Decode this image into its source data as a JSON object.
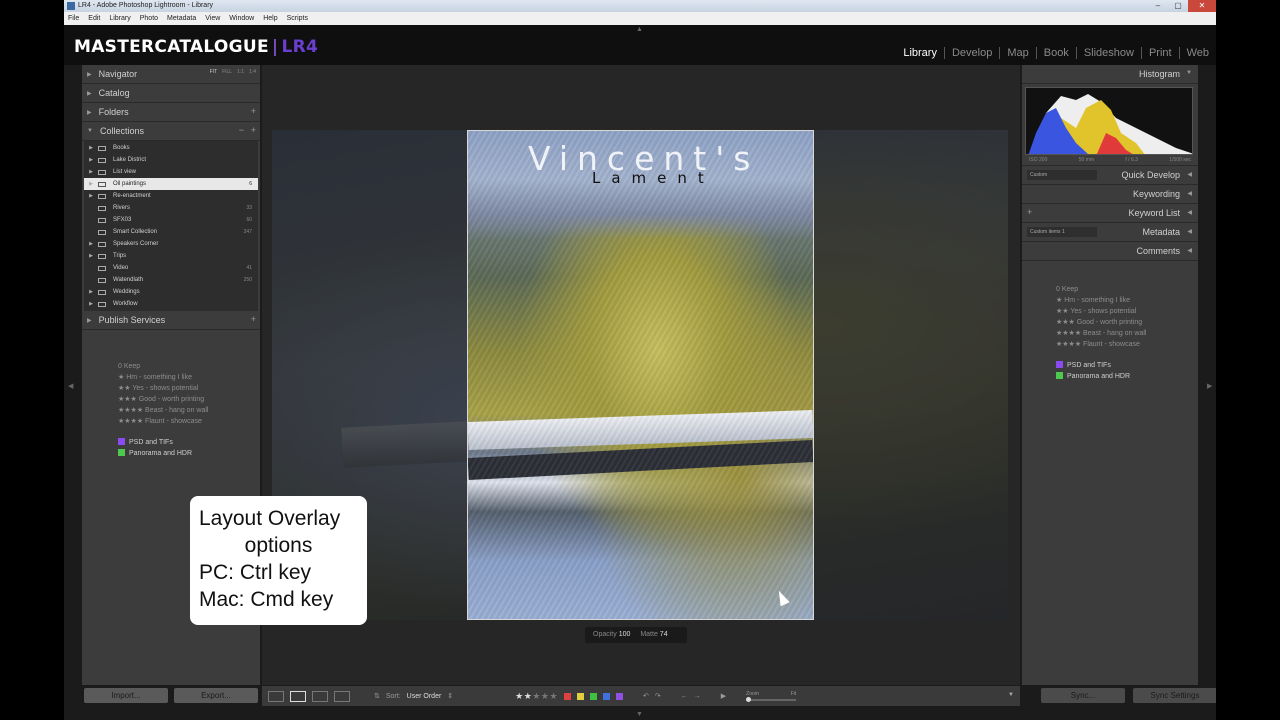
{
  "window": {
    "title": "LR4 - Adobe Photoshop Lightroom - Library",
    "menu": [
      "File",
      "Edit",
      "Library",
      "Photo",
      "Metadata",
      "View",
      "Window",
      "Help",
      "Scripts"
    ]
  },
  "identity": {
    "main": "MASTERCATALOGUE",
    "separator": "|",
    "badge": "LR4"
  },
  "modules": [
    {
      "label": "Library",
      "active": true
    },
    {
      "label": "Develop"
    },
    {
      "label": "Map"
    },
    {
      "label": "Book"
    },
    {
      "label": "Slideshow"
    },
    {
      "label": "Print"
    },
    {
      "label": "Web"
    }
  ],
  "left": {
    "navigator": {
      "label": "Navigator",
      "options": [
        "FIT",
        "FILL",
        "1:1",
        "1:4"
      ]
    },
    "catalog": "Catalog",
    "folders": "Folders",
    "collections": {
      "label": "Collections",
      "items": [
        {
          "name": "Books",
          "count": ""
        },
        {
          "name": "Lake District",
          "count": ""
        },
        {
          "name": "List view",
          "count": ""
        },
        {
          "name": "Oil paintings",
          "count": "6",
          "selected": true
        },
        {
          "name": "Re-enactment",
          "count": ""
        },
        {
          "name": "Rivers",
          "count": "33"
        },
        {
          "name": "SFX03",
          "count": "60"
        },
        {
          "name": "Smart Collection",
          "count": "247"
        },
        {
          "name": "Speakers Corner",
          "count": ""
        },
        {
          "name": "Trips",
          "count": ""
        },
        {
          "name": "Video",
          "count": "41"
        },
        {
          "name": "Watendlath",
          "count": "250"
        },
        {
          "name": "Weddings",
          "count": ""
        },
        {
          "name": "Workflow",
          "count": ""
        }
      ]
    },
    "publish": "Publish Services",
    "import_label": "Import...",
    "export_label": "Export..."
  },
  "legend": {
    "ratings": [
      "0 Keep",
      "★ Hm - something I like",
      "★★ Yes - shows potential",
      "★★★ Good - worth printing",
      "★★★★ Beast - hang on wall",
      "★★★★ Flaunt - showcase"
    ],
    "colors": [
      {
        "label": "PSD and TIFs",
        "color": "#8a4cf0"
      },
      {
        "label": "Panorama and HDR",
        "color": "#4ec94e"
      }
    ]
  },
  "overlay": {
    "title": "Vincent's",
    "subtitle": "Lament",
    "opacity_label": "Opacity",
    "opacity": "100",
    "matte_label": "Matte",
    "matte": "74"
  },
  "callout": {
    "line1": "Layout Overlay",
    "line2": "options",
    "line3": "PC: Ctrl key",
    "line4": "Mac: Cmd key"
  },
  "right": {
    "histogram": "Histogram",
    "histinfo": [
      "ISO 200",
      "50 mm",
      "f / 6.3",
      "1/500 sec"
    ],
    "quick_develop": "Quick Develop",
    "quick_preset": "Custom",
    "keywording": "Keywording",
    "keyword_list": "Keyword List",
    "metadata": "Metadata",
    "metadata_preset": "Custom items 1",
    "comments": "Comments",
    "sync_label": "Sync...",
    "sync_settings_label": "Sync Settings"
  },
  "toolbar": {
    "sort_label": "Sort:",
    "sort_value": "User Order",
    "stars": "★★",
    "stars_dim": "★★★",
    "zoom_label": "Zoom",
    "fit_label": "Fit",
    "label_colors": [
      "#e04040",
      "#e0d040",
      "#40c040",
      "#4070e0",
      "#9050e0"
    ]
  }
}
